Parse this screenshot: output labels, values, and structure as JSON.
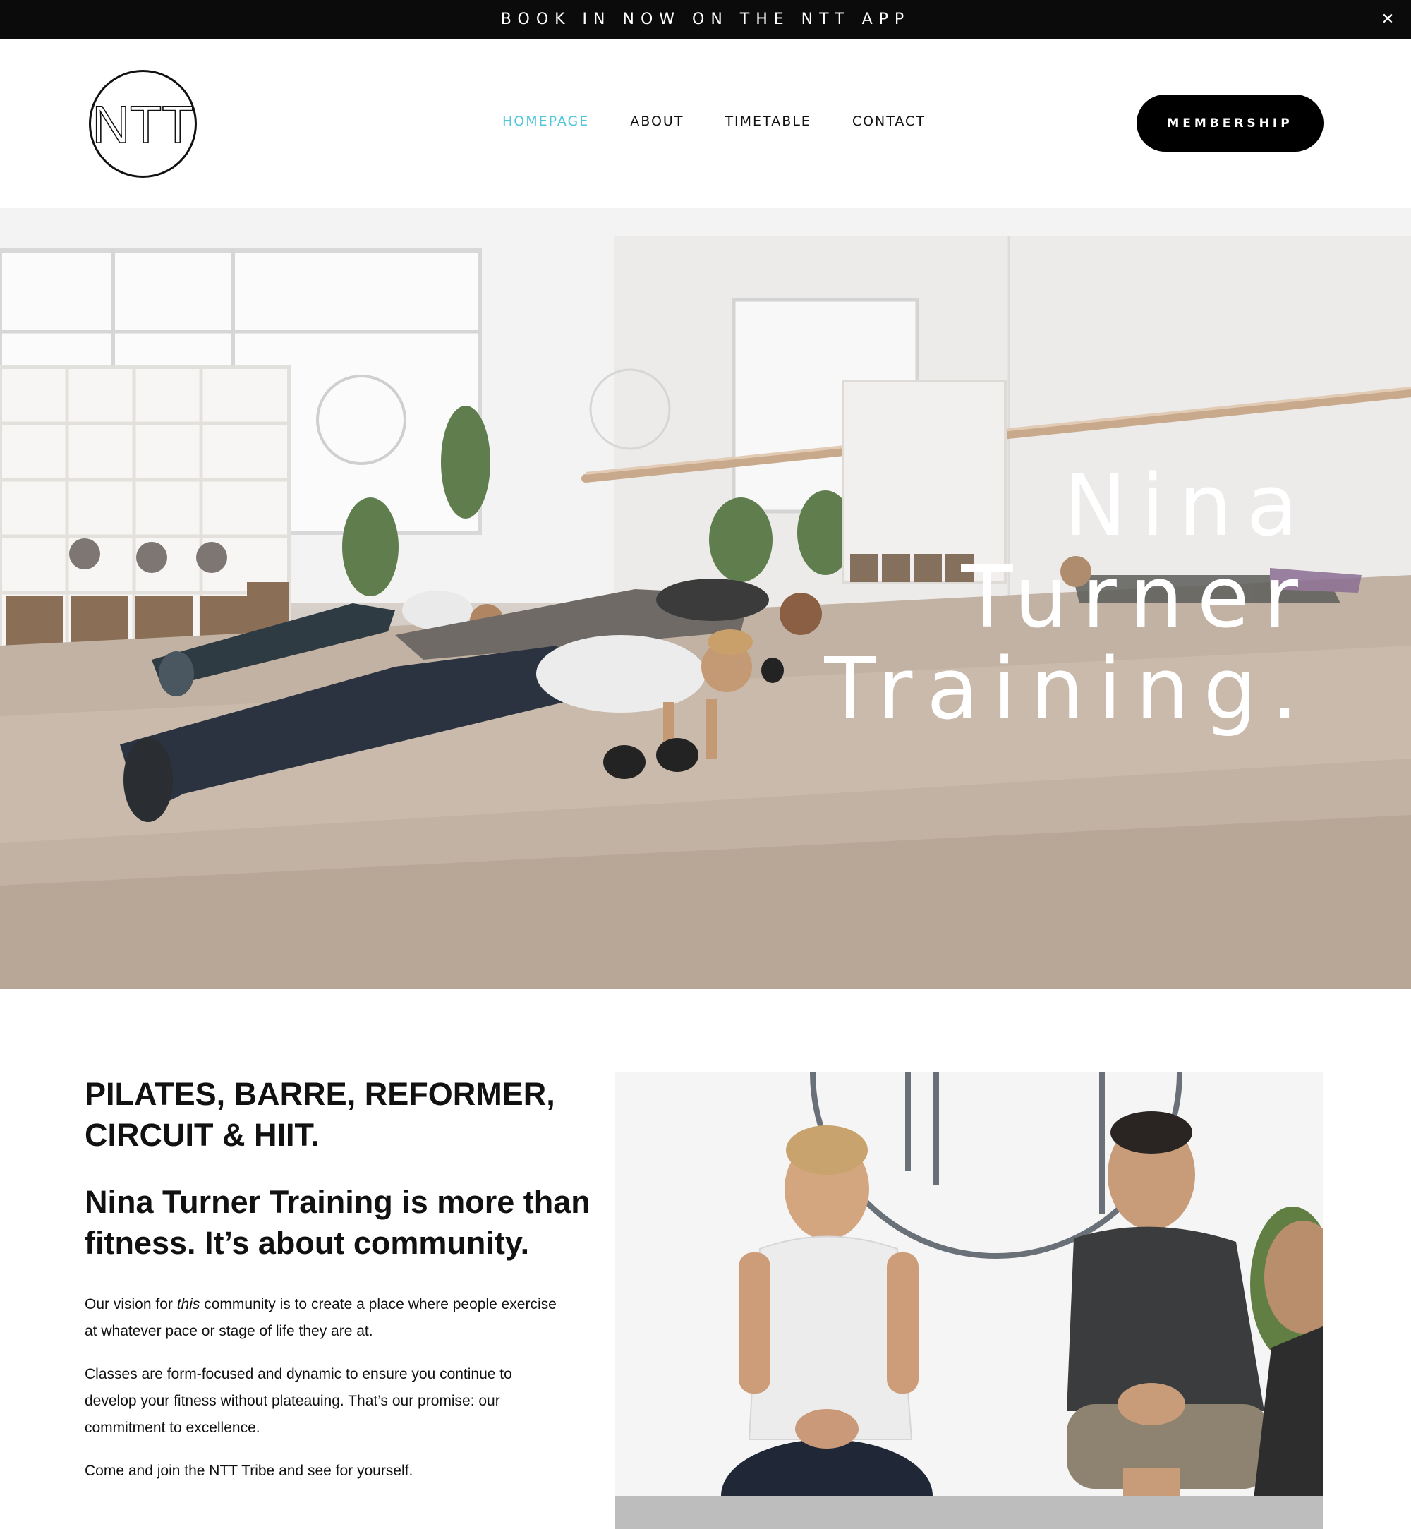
{
  "announcement": {
    "text": "BOOK IN NOW ON THE NTT APP",
    "close_icon": "close-icon"
  },
  "header": {
    "logo_text": "NTT",
    "nav": [
      {
        "label": "HOMEPAGE",
        "active": true
      },
      {
        "label": "ABOUT",
        "active": false
      },
      {
        "label": "TIMETABLE",
        "active": false
      },
      {
        "label": "CONTACT",
        "active": false
      }
    ],
    "membership_label": "MEMBERSHIP"
  },
  "hero": {
    "title_lines": [
      "Nina",
      "Turner",
      "Training."
    ]
  },
  "intro": {
    "heading_classes": "PILATES, BARRE, REFORMER, CIRCUIT & HIIT.",
    "heading_community": "Nina Turner Training is more than fitness. It’s about community.",
    "paragraph1_pre": "Our vision for ",
    "paragraph1_em": "this",
    "paragraph1_post": " community is to create a place where people exercise at whatever pace or stage of life they are at.",
    "paragraph2": "Classes are form-focused and dynamic to ensure you continue to develop your fitness without plateauing. That’s our promise: our commitment to excellence.",
    "paragraph3": "Come and join the NTT Tribe and see for yourself."
  },
  "colors": {
    "accent": "#4fc6d9",
    "bar": "#0b0b0b",
    "button": "#000000"
  }
}
